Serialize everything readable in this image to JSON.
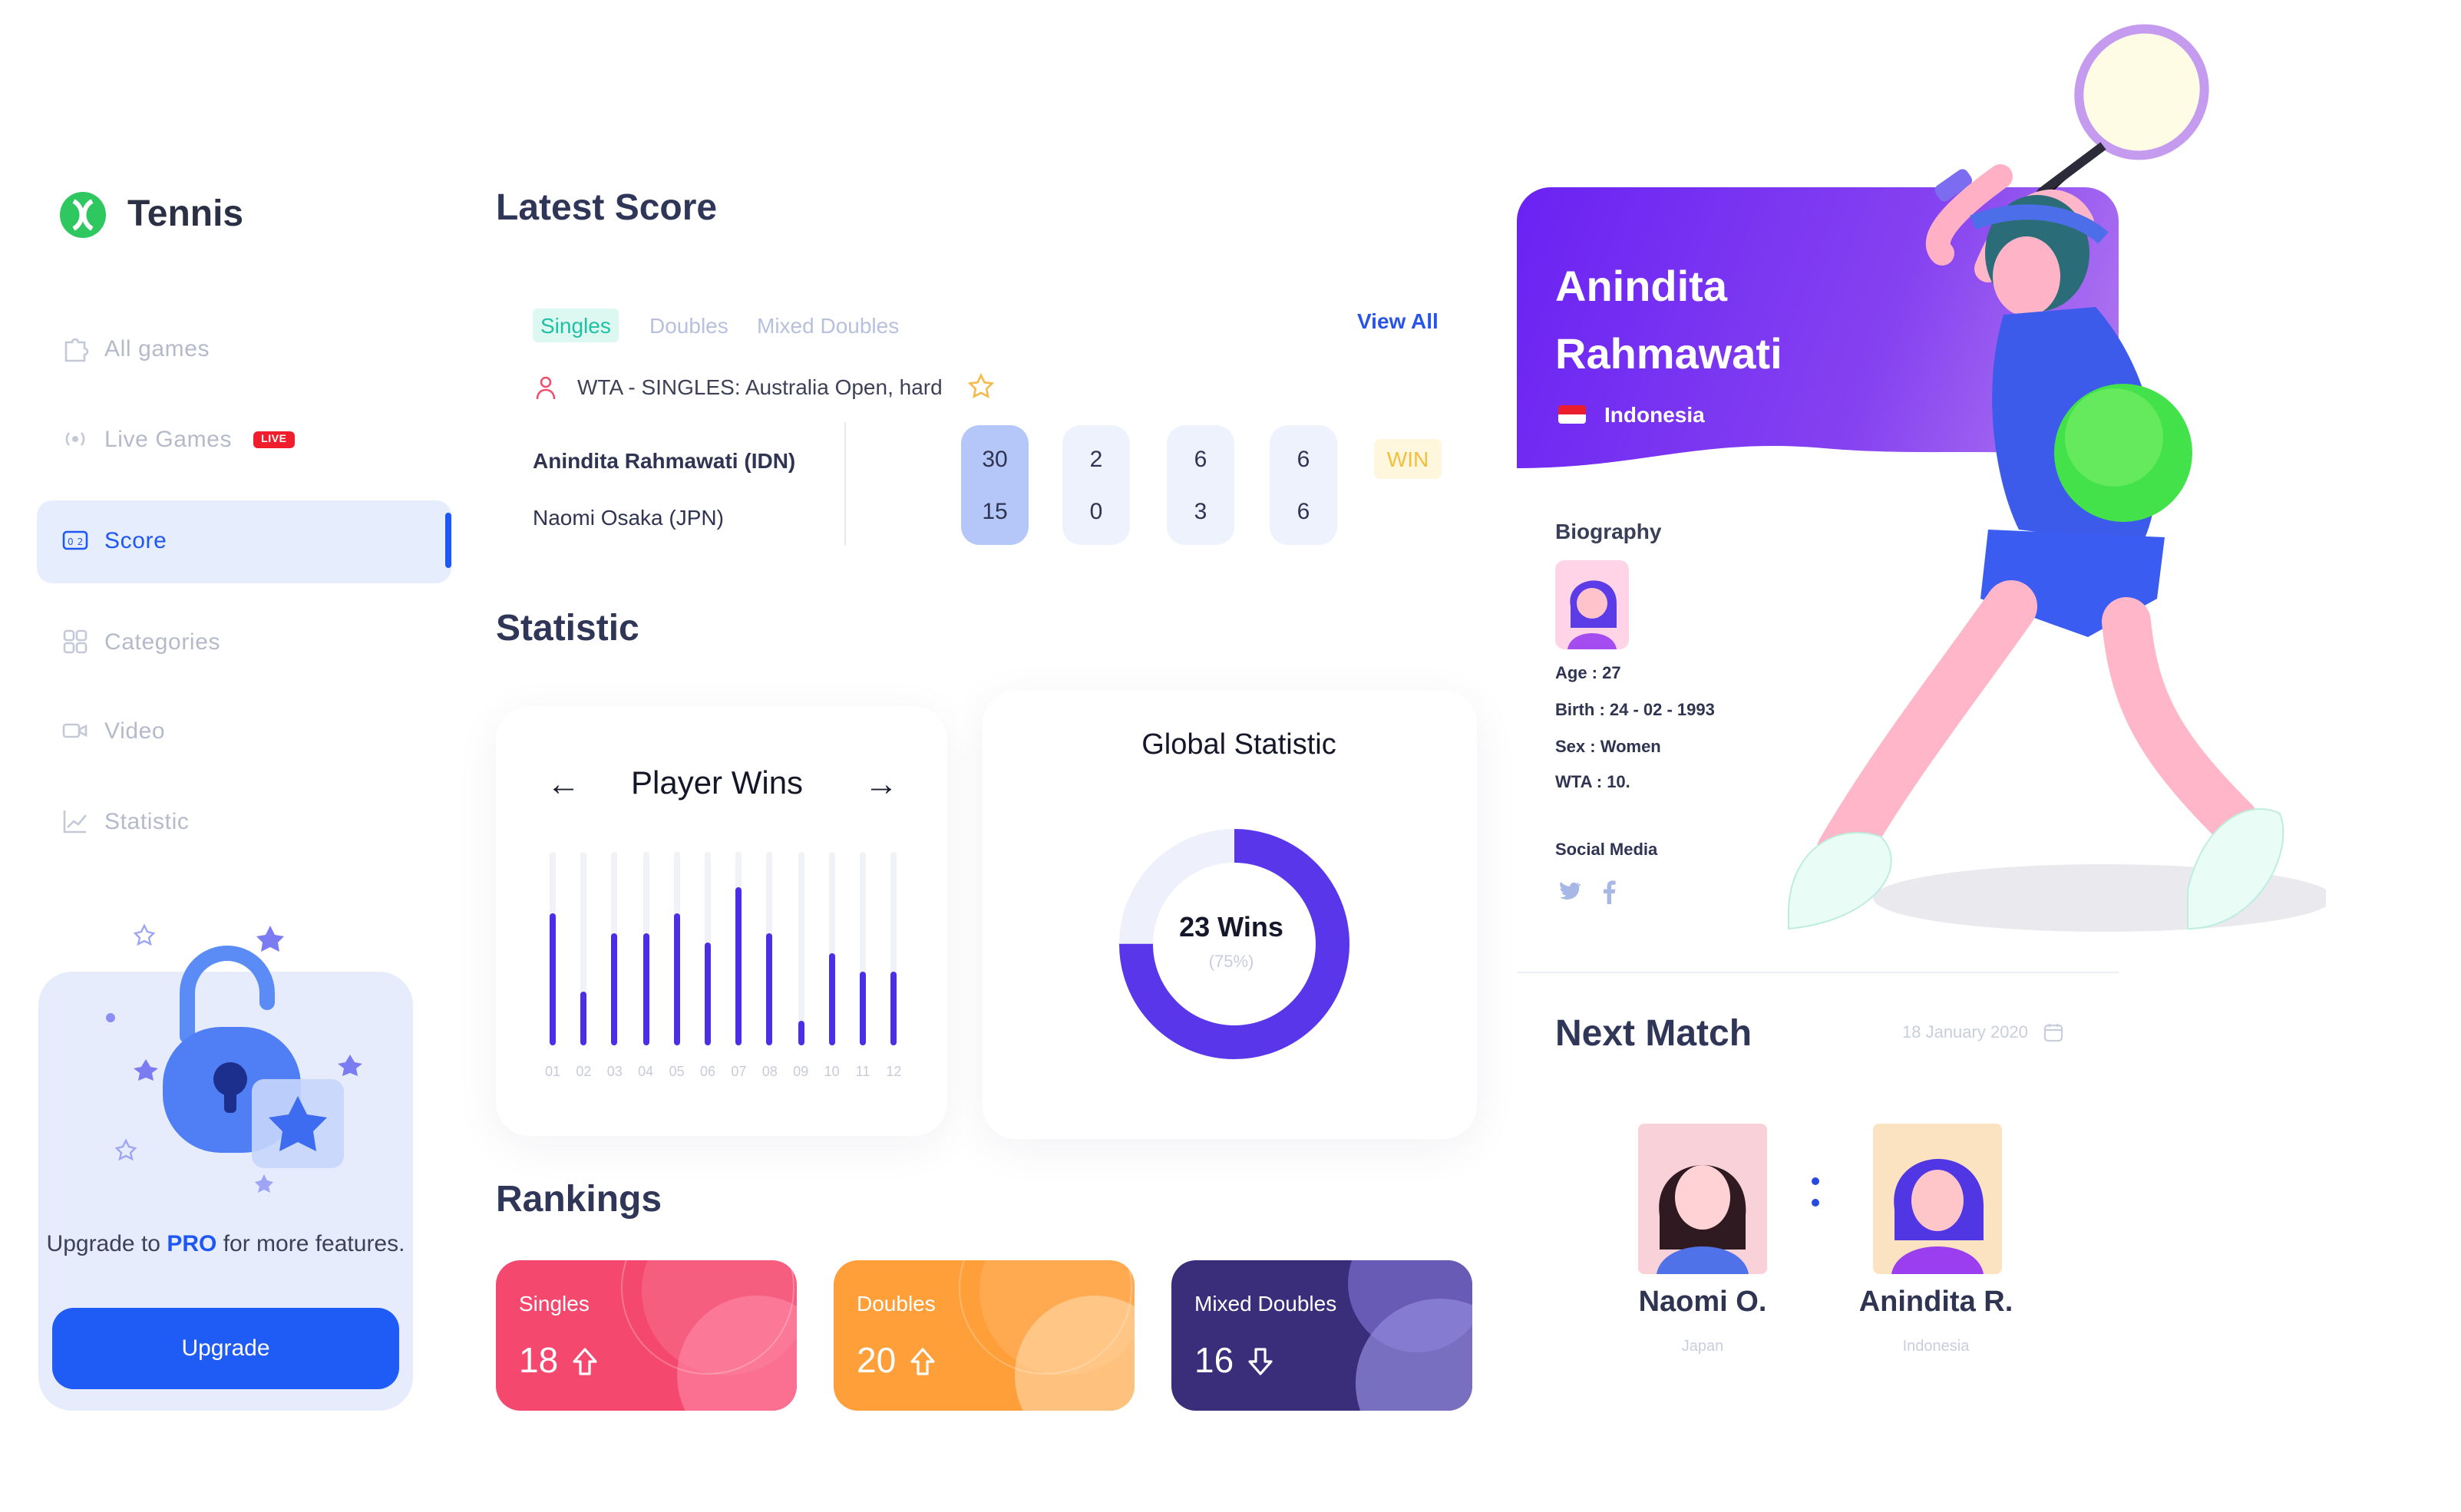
{
  "app": {
    "title": "Tennis"
  },
  "sidebar": {
    "items": [
      {
        "label": "All games",
        "icon": "puzzle-icon"
      },
      {
        "label": "Live Games",
        "icon": "broadcast-icon",
        "badge": "LIVE"
      },
      {
        "label": "Score",
        "icon": "scoreboard-icon",
        "active": true
      },
      {
        "label": "Categories",
        "icon": "grid-icon"
      },
      {
        "label": "Video",
        "icon": "camera-icon"
      },
      {
        "label": "Statistic",
        "icon": "line-chart-icon"
      }
    ],
    "promo": {
      "text_before": "Upgrade to",
      "pro": "PRO",
      "text_after": "for more features.",
      "button": "Upgrade"
    }
  },
  "latest_score": {
    "title": "Latest Score",
    "tabs": [
      "Singles",
      "Doubles",
      "Mixed Doubles"
    ],
    "active_tab": "Singles",
    "view_all": "View All",
    "tournament": "WTA - SINGLES: Australia Open, hard",
    "players": [
      "Anindita Rahmawati (IDN)",
      "Naomi Osaka (JPN)"
    ],
    "sets": [
      [
        "30",
        "15"
      ],
      [
        "2",
        "0"
      ],
      [
        "6",
        "3"
      ],
      [
        "6",
        "6"
      ]
    ],
    "result": "WIN"
  },
  "statistic": {
    "title": "Statistic",
    "player_wins": {
      "title": "Player Wins",
      "prev": "←",
      "next": "→"
    },
    "global": {
      "title": "Global Statistic",
      "value": "23 Wins",
      "percent": "(75%)",
      "fraction": 0.75
    }
  },
  "chart_data": {
    "type": "bar",
    "categories": [
      "01",
      "02",
      "03",
      "04",
      "05",
      "06",
      "07",
      "08",
      "09",
      "10",
      "11",
      "12"
    ],
    "values": [
      68,
      28,
      58,
      58,
      68,
      53,
      82,
      58,
      13,
      48,
      38,
      38
    ],
    "ylim": [
      0,
      100
    ],
    "title": "Player Wins",
    "colors": {
      "bar": "#4b2fe4",
      "track": "#f0f2f8"
    }
  },
  "rankings": {
    "title": "Rankings",
    "cards": [
      {
        "label": "Singles",
        "value": "18",
        "trend": "up",
        "color": "#f5486f"
      },
      {
        "label": "Doubles",
        "value": "20",
        "trend": "up",
        "color": "#ff9f3a"
      },
      {
        "label": "Mixed Doubles",
        "value": "16",
        "trend": "down",
        "color": "#3a2d7a"
      }
    ]
  },
  "profile": {
    "name": "Anindita Rahmawati",
    "country": "Indonesia",
    "biography_label": "Biography",
    "age": "Age : 27",
    "birth": "Birth : 24 - 02 - 1993",
    "sex": "Sex : Women",
    "wta": "WTA : 10.",
    "social_label": "Social Media"
  },
  "next_match": {
    "title": "Next Match",
    "date": "18 January 2020",
    "players": [
      {
        "name": "Naomi O.",
        "country": "Japan"
      },
      {
        "name": "Anindita R.",
        "country": "Indonesia"
      }
    ]
  }
}
